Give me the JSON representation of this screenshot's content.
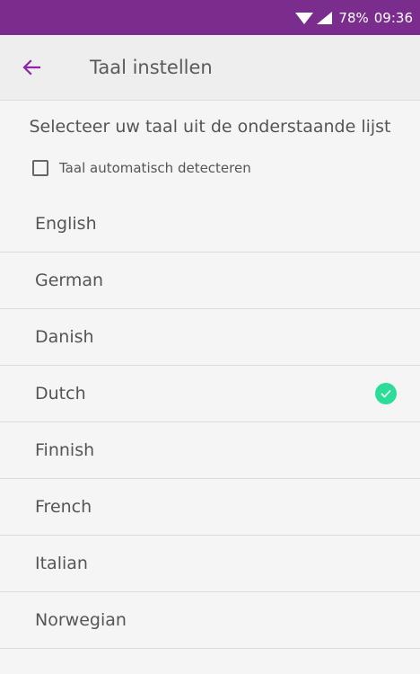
{
  "status_bar": {
    "battery": "78%",
    "time": "09:36",
    "background": "#7b2d8e"
  },
  "app_bar": {
    "title": "Taal instellen",
    "back_icon": "arrow-left-icon",
    "accent": "#8e24aa"
  },
  "instruction": "Selecteer uw taal uit de onderstaande lijst",
  "auto_detect": {
    "label": "Taal automatisch detecteren",
    "checked": false
  },
  "languages": [
    {
      "label": "English",
      "selected": false
    },
    {
      "label": "German",
      "selected": false
    },
    {
      "label": "Danish",
      "selected": false
    },
    {
      "label": "Dutch",
      "selected": true
    },
    {
      "label": "Finnish",
      "selected": false
    },
    {
      "label": "French",
      "selected": false
    },
    {
      "label": "Italian",
      "selected": false
    },
    {
      "label": "Norwegian",
      "selected": false
    }
  ],
  "selected_color": "#2edc9a"
}
